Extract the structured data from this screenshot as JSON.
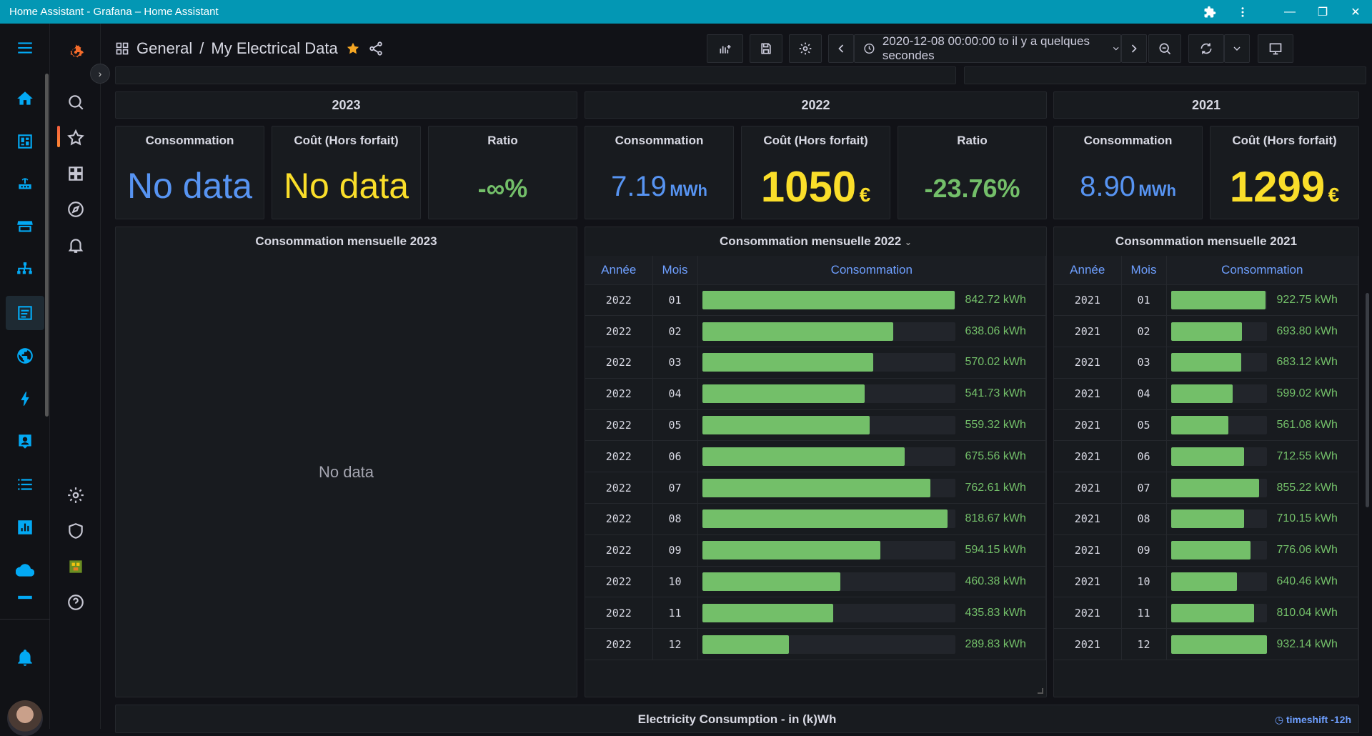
{
  "window": {
    "title": "Home Assistant - Grafana – Home Assistant",
    "controls": [
      "extensions-icon",
      "more-icon",
      "minimize",
      "maximize",
      "close"
    ]
  },
  "ha_sidebar": {
    "items": [
      "menu-icon",
      "home-icon",
      "dashboard-icon",
      "devices-icon",
      "hacs-icon",
      "network-icon",
      "grafana-icon",
      "globe-icon",
      "energy-icon",
      "person-icon",
      "logbook-icon",
      "history-icon",
      "cloud-icon",
      "more-icon",
      "notifications-icon"
    ],
    "active": "grafana-icon"
  },
  "gf_sidebar": {
    "items": [
      "grafana-logo",
      "search-icon",
      "starred-icon",
      "dashboards-icon",
      "explore-icon",
      "alerting-icon",
      "configuration-icon",
      "server-admin-icon",
      "user-avatar",
      "help-icon"
    ],
    "active": "starred-icon"
  },
  "topnav": {
    "folder": "General",
    "separator": "/",
    "dashboard": "My Electrical Data",
    "time_range": "2020-12-08 00:00:00 to il y a quelques secondes"
  },
  "years": {
    "y2023": "2023",
    "y2022": "2022",
    "y2021": "2021"
  },
  "stats": {
    "s2023": {
      "consumption": {
        "title": "Consommation",
        "value": "No data"
      },
      "cost": {
        "title": "Coût (Hors forfait)",
        "value": "No data"
      },
      "ratio": {
        "title": "Ratio",
        "value": "-∞%"
      }
    },
    "s2022": {
      "consumption": {
        "title": "Consommation",
        "value": "7.19",
        "unit": "MWh"
      },
      "cost": {
        "title": "Coût (Hors forfait)",
        "value": "1050",
        "unit": "€"
      },
      "ratio": {
        "title": "Ratio",
        "value": "-23.76%"
      }
    },
    "s2021": {
      "consumption": {
        "title": "Consommation",
        "value": "8.90",
        "unit": "MWh"
      },
      "cost": {
        "title": "Coût (Hors forfait)",
        "value": "1299",
        "unit": "€"
      }
    }
  },
  "monthly": {
    "p2023": {
      "title": "Consommation mensuelle 2023",
      "nodata": "No data"
    },
    "p2022": {
      "title": "Consommation mensuelle 2022"
    },
    "p2021": {
      "title": "Consommation mensuelle 2021"
    },
    "headers": {
      "year": "Année",
      "month": "Mois",
      "consumption": "Consommation"
    },
    "unit": "kWh",
    "rows2022": [
      {
        "year": "2022",
        "month": "01",
        "value": 842.72,
        "label": "842.72 kWh"
      },
      {
        "year": "2022",
        "month": "02",
        "value": 638.06,
        "label": "638.06 kWh"
      },
      {
        "year": "2022",
        "month": "03",
        "value": 570.02,
        "label": "570.02 kWh"
      },
      {
        "year": "2022",
        "month": "04",
        "value": 541.73,
        "label": "541.73 kWh"
      },
      {
        "year": "2022",
        "month": "05",
        "value": 559.32,
        "label": "559.32 kWh"
      },
      {
        "year": "2022",
        "month": "06",
        "value": 675.56,
        "label": "675.56 kWh"
      },
      {
        "year": "2022",
        "month": "07",
        "value": 762.61,
        "label": "762.61 kWh"
      },
      {
        "year": "2022",
        "month": "08",
        "value": 818.67,
        "label": "818.67 kWh"
      },
      {
        "year": "2022",
        "month": "09",
        "value": 594.15,
        "label": "594.15 kWh"
      },
      {
        "year": "2022",
        "month": "10",
        "value": 460.38,
        "label": "460.38 kWh"
      },
      {
        "year": "2022",
        "month": "11",
        "value": 435.83,
        "label": "435.83 kWh"
      },
      {
        "year": "2022",
        "month": "12",
        "value": 289.83,
        "label": "289.83 kWh"
      }
    ],
    "rows2021": [
      {
        "year": "2021",
        "month": "01",
        "value": 922.75,
        "label": "922.75 kWh"
      },
      {
        "year": "2021",
        "month": "02",
        "value": 693.8,
        "label": "693.80 kWh"
      },
      {
        "year": "2021",
        "month": "03",
        "value": 683.12,
        "label": "683.12 kWh"
      },
      {
        "year": "2021",
        "month": "04",
        "value": 599.02,
        "label": "599.02 kWh"
      },
      {
        "year": "2021",
        "month": "05",
        "value": 561.08,
        "label": "561.08 kWh"
      },
      {
        "year": "2021",
        "month": "06",
        "value": 712.55,
        "label": "712.55 kWh"
      },
      {
        "year": "2021",
        "month": "07",
        "value": 855.22,
        "label": "855.22 kWh"
      },
      {
        "year": "2021",
        "month": "08",
        "value": 710.15,
        "label": "710.15 kWh"
      },
      {
        "year": "2021",
        "month": "09",
        "value": 776.06,
        "label": "776.06 kWh"
      },
      {
        "year": "2021",
        "month": "10",
        "value": 640.46,
        "label": "640.46 kWh"
      },
      {
        "year": "2021",
        "month": "11",
        "value": 810.04,
        "label": "810.04 kWh"
      },
      {
        "year": "2021",
        "month": "12",
        "value": 932.14,
        "label": "932.14 kWh"
      }
    ]
  },
  "bottom_panel": {
    "title": "Electricity Consumption - in (k)Wh",
    "timeshift": "timeshift -12h"
  },
  "colors": {
    "accent": "#0397b4",
    "blue": "#5794f2",
    "yellow": "#fade2a",
    "green": "#73bf69"
  }
}
